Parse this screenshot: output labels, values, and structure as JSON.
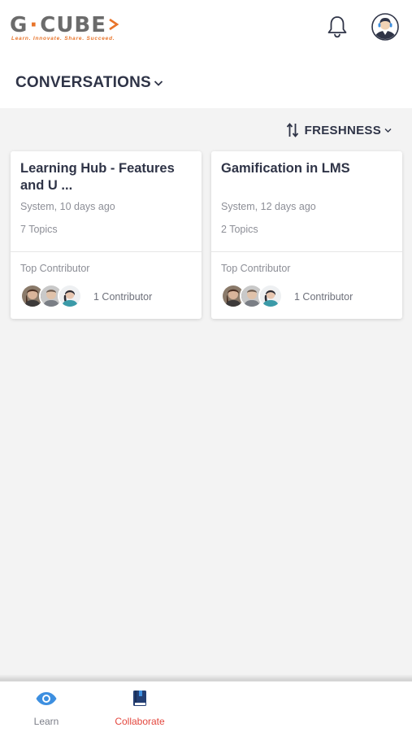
{
  "header": {
    "logo_text_1": "G",
    "logo_dot": "·",
    "logo_text_2": "CUBE",
    "logo_tagline": "Learn. Innovate. Share. Succeed.",
    "bell_icon": "bell-icon",
    "avatar_icon": "user-avatar"
  },
  "section": {
    "title": "CONVERSATIONS"
  },
  "sort": {
    "label": "FRESHNESS",
    "icon": "sort-icon"
  },
  "cards": [
    {
      "title": "Learning Hub - Features and U ...",
      "meta": "System, 10 days ago",
      "topics": "7 Topics",
      "top_contributor_label": "Top Contributor",
      "contributor_count": "1 Contributor"
    },
    {
      "title": "Gamification in LMS",
      "meta": "System, 12 days ago",
      "topics": "2 Topics",
      "top_contributor_label": "Top Contributor",
      "contributor_count": "1 Contributor"
    }
  ],
  "bottom_nav": {
    "items": [
      {
        "label": "Learn",
        "icon": "eye-icon",
        "active": false
      },
      {
        "label": "Collaborate",
        "icon": "book-icon",
        "active": true
      }
    ]
  },
  "colors": {
    "brand_orange": "#e8742a",
    "active_red": "#e3473e",
    "learn_blue": "#3d8fe0",
    "text_dark": "#2f3447",
    "text_muted": "#8d8f97"
  }
}
